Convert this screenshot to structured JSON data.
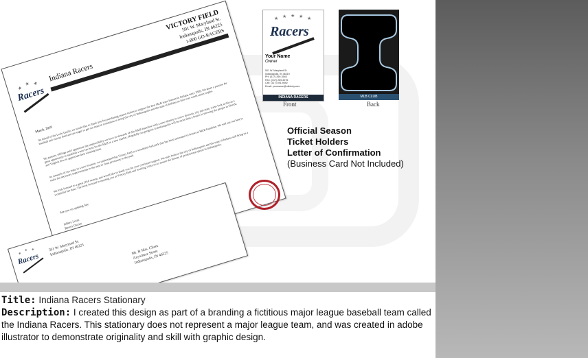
{
  "letter": {
    "team_name": "Indiana Racers",
    "venue_name": "VICTORY FIELD",
    "venue_address": [
      "501 W. Maryland St.",
      "Indianapolis, IN 46225",
      "1-800 GO-RACERS"
    ],
    "date": "March, 2010",
    "paragraphs": [
      "On behalf of the Lorin family, we would like to thank you for purchasing season tickets to support the first MLB team formed in Indiana since 1889. We share a passion for baseball and victory field and are eager to get our team in contention to bring the city of Indianapolis and the state of Indiana its first ever world series trophy.",
      "My parents, siblings and I appreciate the responsibility we have as stewards of this MLB franchise with a new identity in a new division, city and state. I also look at this as a great opportunity to establish a new fan base for the MLB in a new market. Hopefully our progress in Indianapolis will be more than a lesson in showing the people in Florida and Virginia how to appreciate their winning team.",
      "As stewards of our team in a new location, we understand that Victory field is a wonderful ball park that has been renovated to house an MLB franchise. We will use our best to make the necessary improvements to the area in close proximity to the park.",
      "We look forward to a great 2010 season, and would like to thank you for your continued support. We truly believe the city of Indianapolis and the state of Indiana will bring us a wonderful fan base. The book forward to meeting you at Victory field and working with you to ensure the history of professional sports in Indianapolis."
    ],
    "closing": "See you on opening day",
    "signer_name": "Jeffery Lorin",
    "signer_title": "Racers Owner"
  },
  "envelope": {
    "return_address": [
      "501 W. Maryland St.",
      "Indianapolis, IN 46225"
    ],
    "recipient": [
      "Mr. & Mrs. Client",
      "Anywhere Street",
      "Indianapolis, IN 46225"
    ]
  },
  "logo": {
    "wordmark": "Racers"
  },
  "business_card": {
    "name": "Your Name",
    "title": "Owner",
    "address": [
      "501 W. Maryland St.",
      "Indianapolis, IN 46219",
      "PH: (317) 269-3545",
      "FAX: (317) 269-3276",
      "Cell: (317) 591-9692",
      "Email: yourname@mlbindy.com"
    ],
    "footer": "INDIANA RACERS",
    "back_footer": "MLB CLUB",
    "front_caption": "Front",
    "back_caption": "Back"
  },
  "items_list": {
    "bold_lines": [
      "Official Season",
      "Ticket Holders",
      "Letter of Confirmation"
    ],
    "note": "(Business Card Not Included)"
  },
  "caption": {
    "title_label": "Title:",
    "title": "Indiana Racers Stationary",
    "description_label": "Description:",
    "description": "I created this design as part of a branding a fictitious major league baseball team called the Indiana Racers.  This stationary does not represent a major league team, and was created in adobe illustrator to demonstrate originality and skill with graphic design."
  },
  "colors": {
    "seal_red": "#b0202a",
    "navy": "#1d3150",
    "card_footer": "#1d2a3a",
    "back_footer": "#2a5070",
    "outline_blue": "#a8c8e0"
  }
}
